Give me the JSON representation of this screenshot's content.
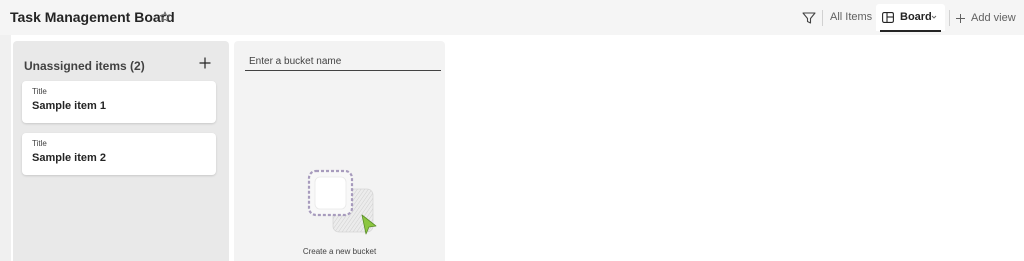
{
  "header": {
    "title": "Task Management Board",
    "views": {
      "all_items": "All Items",
      "board": "Board",
      "add_view": "Add view"
    }
  },
  "buckets": {
    "unassigned": {
      "title": "Unassigned items (2)",
      "cards": [
        {
          "field_label": "Title",
          "value": "Sample item 1"
        },
        {
          "field_label": "Title",
          "value": "Sample item 2"
        }
      ]
    },
    "new_bucket": {
      "placeholder": "Enter a bucket name",
      "create_label": "Create a new bucket"
    }
  },
  "colors": {
    "accent_green": "#8cc63f",
    "text": "#242424",
    "muted": "#616161"
  },
  "icons": [
    "star-icon",
    "filter-icon",
    "board-icon",
    "chevron-down-icon",
    "plus-icon",
    "create-bucket-illustration"
  ]
}
